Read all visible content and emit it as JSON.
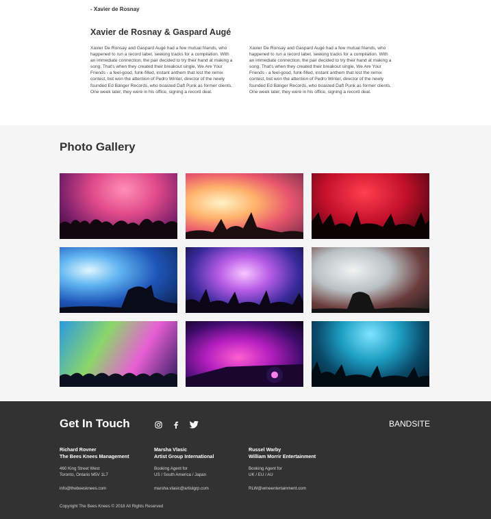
{
  "about": {
    "quote_author": "- Xavier de Rosnay",
    "title": "Xavier de Rosnay & Gaspard Augé",
    "paragraph_left": "Xavier De Ronsay and Gaspard Augé had a few mutual friends, who happened to run a record label, seeking tracks for a compilation. With an immediate connection, the pair decided to try their hand at making a song. That's when they created their breakout single, We Are Your Friends - a feel-good, funk-filled, instant anthem that lost the remix contest, but won the attention of Pedro Winter, director of the newly founded Ed Banger Records, who boasted Daft Punk as former clients. One week later, they were in his office, signing a record deal.",
    "paragraph_right": "Xavier De Ronsay and Gaspard Augé had a few mutual friends, who happened to run a record label, seeking tracks for a compilation. With an immediate connection, the pair decided to try their hand at making a song. That's when they created their breakout single, We Are Your Friends - a feel-good, funk-filled, instant anthem that lost the remix contest, but won the attention of Pedro Winter, director of the newly founded Ed Banger Records, who boasted Daft Punk as former clients. One week later, they were in his office, signing a record deal."
  },
  "gallery": {
    "title": "Photo Gallery"
  },
  "footer": {
    "title": "Get In Touch",
    "social_icons": [
      "instagram-icon",
      "facebook-icon",
      "twitter-icon"
    ],
    "brand": "BANDSITE",
    "contacts": [
      {
        "name": "Richard Rovner",
        "agency": "The Bees Knees Management",
        "line1": "460 King Street West",
        "line2": "Toronto, Ontario M5V 1L7",
        "email": "info@thebeesknees.com"
      },
      {
        "name": "Marsha Vlasic",
        "agency": "Artist Group International",
        "line1": "Booking Agent for",
        "line2": "US / South America / Japan",
        "email": "marsha.vlasic@artistgrp.com"
      },
      {
        "name": "Russel Warby",
        "agency": "William Morrir Entertainment",
        "line1": "Booking Agent for",
        "line2": "UK / EU / AU",
        "email": "RLW@wmeentertainment.com"
      }
    ],
    "copyright": "Copyright The Bees Knees © 2018 All Rights Reserved"
  },
  "colors": {
    "gallery_bg": "#f5f5f5",
    "footer_bg": "#323232",
    "text_dark": "#323232"
  }
}
